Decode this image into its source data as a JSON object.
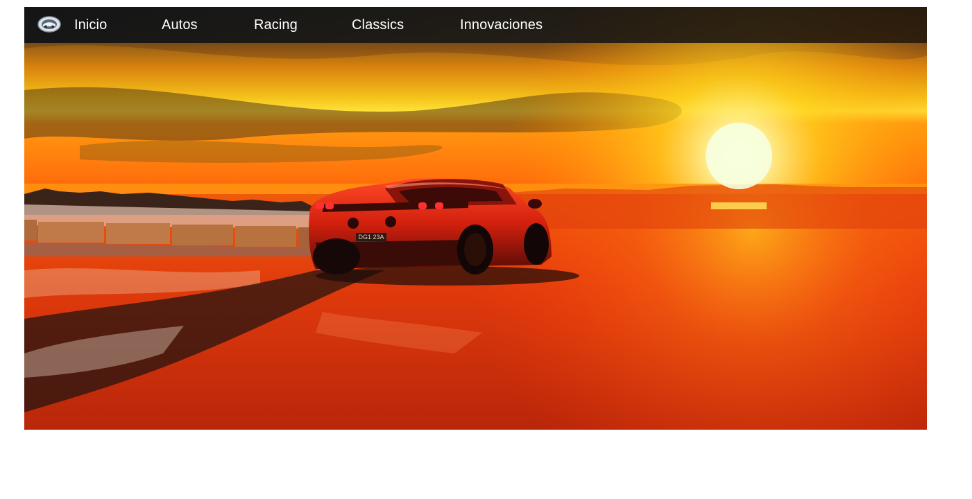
{
  "nav": {
    "logo_icon": "car-badge-icon",
    "items": [
      {
        "label": "Inicio"
      },
      {
        "label": "Autos"
      },
      {
        "label": "Racing"
      },
      {
        "label": "Classics"
      },
      {
        "label": "Innovaciones"
      }
    ]
  },
  "hero": {
    "image_description_icon": "sunset-car-photo",
    "license_plate": "DG1 23A"
  },
  "colors": {
    "nav_background": "#141516",
    "nav_text": "#ffffff",
    "sun": "#f4ffd8",
    "sky_orange": "#f08a10",
    "ground_red": "#d6320c",
    "car_red": "#c91f10"
  }
}
